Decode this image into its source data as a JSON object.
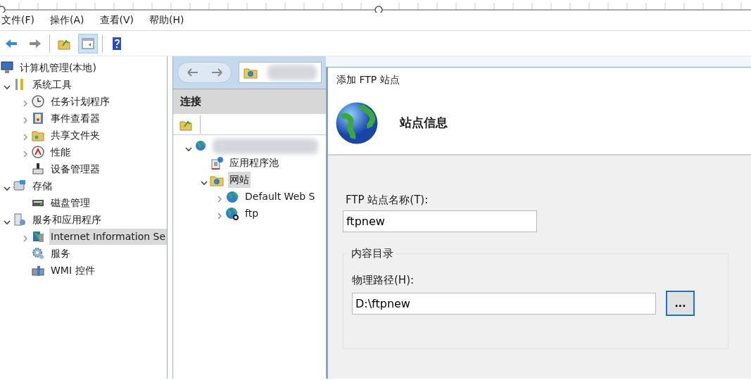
{
  "menu": [
    {
      "label": "文件(F)"
    },
    {
      "label": "操作(A)"
    },
    {
      "label": "查看(V)"
    },
    {
      "label": "帮助(H)"
    }
  ],
  "toolbar": [
    {
      "pressed": false
    },
    {
      "pressed": false
    },
    {
      "pressed": false
    },
    {
      "pressed": true
    },
    {
      "pressed": false
    }
  ],
  "console_tree": [
    {
      "label": "计算机管理(本地)",
      "selected": false,
      "children": [
        {
          "label": "系统工具",
          "expanded": true,
          "selected": false,
          "children": [
            {
              "label": "任务计划程序",
              "expanded": false,
              "selected": false
            },
            {
              "label": "事件查看器",
              "expanded": false,
              "selected": false
            },
            {
              "label": "共享文件夹",
              "expanded": false,
              "selected": false
            },
            {
              "label": "性能",
              "expanded": false,
              "selected": false
            },
            {
              "label": "设备管理器",
              "selected": false
            }
          ]
        },
        {
          "label": "存储",
          "expanded": true,
          "selected": false,
          "children": [
            {
              "label": "磁盘管理",
              "selected": false
            }
          ]
        },
        {
          "label": "服务和应用程序",
          "expanded": true,
          "selected": false,
          "children": [
            {
              "label": "Internet Information Se",
              "expanded": false,
              "selected": true
            },
            {
              "label": "服务",
              "selected": false
            },
            {
              "label": "WMI 控件",
              "selected": false
            }
          ]
        }
      ]
    }
  ],
  "connections": {
    "title": "连接",
    "tree": [
      {
        "expanded": true,
        "selected": false,
        "children": [
          {
            "label": "应用程序池",
            "selected": false
          },
          {
            "label": "网站",
            "expanded": true,
            "selected": true,
            "children": [
              {
                "label": "Default Web S",
                "expanded": false,
                "selected": false
              },
              {
                "label": "ftp",
                "expanded": false,
                "selected": false
              }
            ]
          }
        ]
      }
    ]
  },
  "dialog": {
    "title": "添加 FTP 站点",
    "heading": "站点信息",
    "site_name": {
      "label": "FTP 站点名称(T):",
      "value": "ftpnew"
    },
    "content_directory": {
      "legend": "内容目录",
      "label": "物理路径(H):",
      "value": "D:\\ftpnew",
      "browse_button": "..."
    }
  }
}
